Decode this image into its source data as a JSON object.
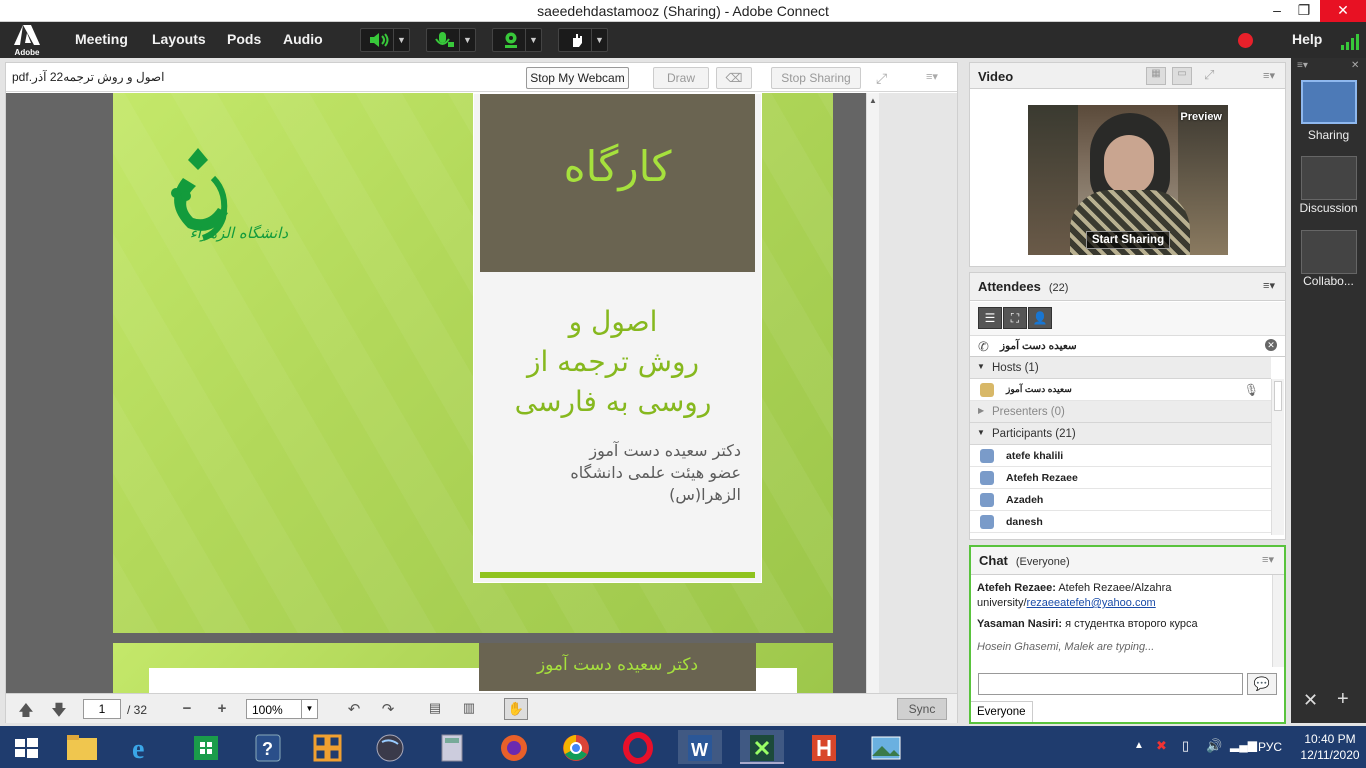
{
  "window": {
    "title": "saeedehdastamooz (Sharing) - Adobe Connect",
    "minimize": "–",
    "maximize": "❐",
    "close": "✕"
  },
  "menubar": {
    "logo_text": "Adobe",
    "items": [
      "Meeting",
      "Layouts",
      "Pods",
      "Audio"
    ],
    "help": "Help",
    "accent": "#2b2b2b"
  },
  "share": {
    "filename": "اصول و روش ترجمه22 آذر.pdf",
    "stop_webcam": "Stop My Webcam",
    "draw": "Draw",
    "stop_sharing": "Stop Sharing",
    "page_current": "1",
    "page_total": "/ 32",
    "zoom": "100%",
    "sync": "Sync",
    "slide": {
      "workshop": "کارگاه",
      "title_line1": "اصول و",
      "title_line2": "روش ترجمه  از",
      "title_line3": "روسی به فارسی",
      "author": "دکتر سعیده دست آموز",
      "position1": "عضو هیئت علمی دانشگاه",
      "position2": "الزهرا(س)",
      "logo_text": "دانشگاه الزهراء",
      "next_slide_text": "دکتر سعیده دست آموز"
    }
  },
  "video": {
    "title": "Video",
    "preview": "Preview",
    "start_sharing": "Start Sharing"
  },
  "attendees": {
    "title": "Attendees",
    "count": "(22)",
    "host_name_field": "سعیده دست آموز",
    "hosts_label": "Hosts (1)",
    "host_row": "سعیده دست آموز",
    "presenters_label": "Presenters (0)",
    "participants_label": "Participants (21)",
    "participants": [
      "atefe khalili",
      "Atefeh Rezaee",
      "Azadeh",
      "danesh"
    ]
  },
  "chat": {
    "title": "Chat",
    "scope": "(Everyone)",
    "messages": [
      {
        "sender": "Atefeh Rezaee:",
        "text": "Atefeh Rezaee/Alzahra university/",
        "link": "rezaeeatefeh@yahoo.com"
      },
      {
        "sender": "Yasaman Nasiri:",
        "text": "я студентка второго курса"
      }
    ],
    "typing": "Hosein Ghasemi, Malek are typing...",
    "recipient_tab": "Everyone"
  },
  "layouts": {
    "items": [
      "Sharing",
      "Discussion",
      "Collabo..."
    ]
  },
  "taskbar": {
    "lang": "РУС",
    "time": "10:40 PM",
    "date": "12/11/2020"
  }
}
